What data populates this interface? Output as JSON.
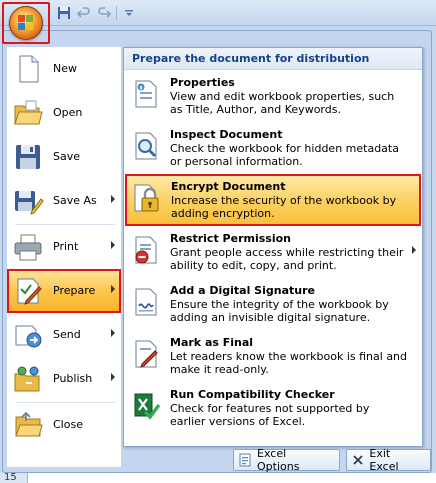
{
  "qat": {
    "icons": [
      "save-icon",
      "undo-icon",
      "redo-icon",
      "customize-icon"
    ]
  },
  "left_menu": [
    {
      "label": "New",
      "accesskey": "N",
      "icon": "new-doc-icon",
      "arrow": false
    },
    {
      "label": "Open",
      "accesskey": "O",
      "icon": "open-folder-icon",
      "arrow": false
    },
    {
      "label": "Save",
      "accesskey": "S",
      "icon": "save-icon",
      "arrow": false
    },
    {
      "label": "Save As",
      "accesskey": "A",
      "icon": "save-as-icon",
      "arrow": true
    },
    {
      "label": "Print",
      "accesskey": "P",
      "icon": "printer-icon",
      "arrow": true
    },
    {
      "label": "Prepare",
      "accesskey": "E",
      "icon": "prepare-icon",
      "arrow": true,
      "selected": true
    },
    {
      "label": "Send",
      "accesskey": "D",
      "icon": "send-icon",
      "arrow": true
    },
    {
      "label": "Publish",
      "accesskey": "U",
      "icon": "publish-icon",
      "arrow": true
    },
    {
      "label": "Close",
      "accesskey": "C",
      "icon": "close-folder-icon",
      "arrow": false
    }
  ],
  "panel": {
    "header": "Prepare the document for distribution",
    "options": [
      {
        "title": "Properties",
        "description": "View and edit workbook properties, such as Title, Author, and Keywords.",
        "icon": "properties-icon"
      },
      {
        "title": "Inspect Document",
        "description": "Check the workbook for hidden metadata or personal information.",
        "icon": "inspect-document-icon"
      },
      {
        "title": "Encrypt Document",
        "description": "Increase the security of the workbook by adding encryption.",
        "icon": "encrypt-lock-icon",
        "selected": true
      },
      {
        "title": "Restrict Permission",
        "description": "Grant people access while restricting their ability to edit, copy, and print.",
        "icon": "restrict-permission-icon",
        "arrow": true
      },
      {
        "title": "Add a Digital Signature",
        "description": "Ensure the integrity of the workbook by adding an invisible digital signature.",
        "icon": "digital-signature-icon"
      },
      {
        "title": "Mark as Final",
        "description": "Let readers know the workbook is final and make it read-only.",
        "icon": "mark-final-icon"
      },
      {
        "title": "Run Compatibility Checker",
        "description": "Check for features not supported by earlier versions of Excel.",
        "icon": "compatibility-checker-icon"
      }
    ]
  },
  "footer": {
    "options_label": "Excel Options",
    "exit_label": "Exit Excel"
  },
  "sheet": {
    "row_number": "15"
  },
  "colors": {
    "highlight": "#e0141a",
    "selected_fill": "#fcc74e",
    "text_blue": "#15428b"
  }
}
